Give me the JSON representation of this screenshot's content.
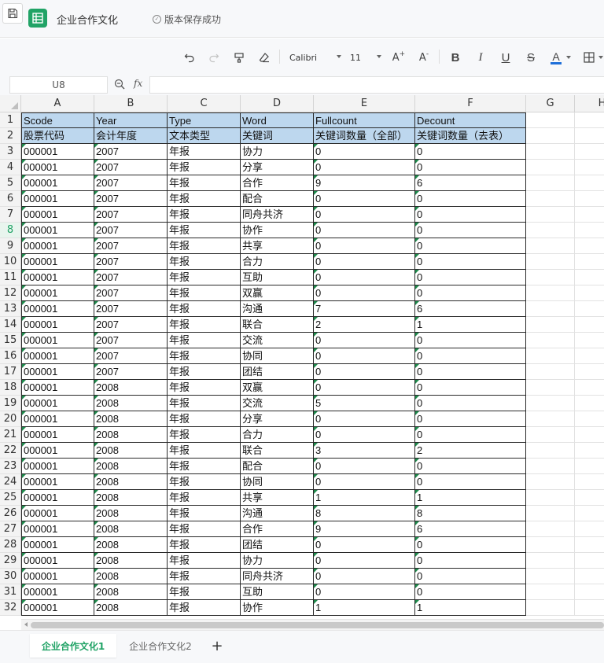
{
  "app": {
    "title": "企业合作文化",
    "save_status": "版本保存成功",
    "accent": "#21a366"
  },
  "toolbar": {
    "font": "Calibri",
    "size": "11",
    "bold": "B",
    "italic": "I",
    "underline": "U",
    "strike": "S",
    "font_color": "A",
    "grow": "A",
    "shrink": "A",
    "icons": [
      "undo-icon",
      "redo-icon",
      "format-painter-icon",
      "eraser-icon",
      "borders-icon"
    ]
  },
  "formula_bar": {
    "cell_ref": "U8",
    "fx": "fx",
    "value": ""
  },
  "grid": {
    "columns": [
      "A",
      "B",
      "C",
      "D",
      "E",
      "F",
      "G",
      "H"
    ],
    "rows": [
      [
        "Scode",
        "Year",
        "Type",
        "Word",
        "Fullcount",
        "Decount"
      ],
      [
        "股票代码",
        "会计年度",
        "文本类型",
        "关键词",
        "关键词数量（全部）",
        "关键词数量（去表）"
      ],
      [
        "000001",
        "2007",
        "年报",
        "协力",
        "0",
        "0"
      ],
      [
        "000001",
        "2007",
        "年报",
        "分享",
        "0",
        "0"
      ],
      [
        "000001",
        "2007",
        "年报",
        "合作",
        "9",
        "6"
      ],
      [
        "000001",
        "2007",
        "年报",
        "配合",
        "0",
        "0"
      ],
      [
        "000001",
        "2007",
        "年报",
        "同舟共济",
        "0",
        "0"
      ],
      [
        "000001",
        "2007",
        "年报",
        "协作",
        "0",
        "0"
      ],
      [
        "000001",
        "2007",
        "年报",
        "共享",
        "0",
        "0"
      ],
      [
        "000001",
        "2007",
        "年报",
        "合力",
        "0",
        "0"
      ],
      [
        "000001",
        "2007",
        "年报",
        "互助",
        "0",
        "0"
      ],
      [
        "000001",
        "2007",
        "年报",
        "双赢",
        "0",
        "0"
      ],
      [
        "000001",
        "2007",
        "年报",
        "沟通",
        "7",
        "6"
      ],
      [
        "000001",
        "2007",
        "年报",
        "联合",
        "2",
        "1"
      ],
      [
        "000001",
        "2007",
        "年报",
        "交流",
        "0",
        "0"
      ],
      [
        "000001",
        "2007",
        "年报",
        "协同",
        "0",
        "0"
      ],
      [
        "000001",
        "2007",
        "年报",
        "团结",
        "0",
        "0"
      ],
      [
        "000001",
        "2008",
        "年报",
        "双赢",
        "0",
        "0"
      ],
      [
        "000001",
        "2008",
        "年报",
        "交流",
        "5",
        "0"
      ],
      [
        "000001",
        "2008",
        "年报",
        "分享",
        "0",
        "0"
      ],
      [
        "000001",
        "2008",
        "年报",
        "合力",
        "0",
        "0"
      ],
      [
        "000001",
        "2008",
        "年报",
        "联合",
        "3",
        "2"
      ],
      [
        "000001",
        "2008",
        "年报",
        "配合",
        "0",
        "0"
      ],
      [
        "000001",
        "2008",
        "年报",
        "协同",
        "0",
        "0"
      ],
      [
        "000001",
        "2008",
        "年报",
        "共享",
        "1",
        "1"
      ],
      [
        "000001",
        "2008",
        "年报",
        "沟通",
        "8",
        "8"
      ],
      [
        "000001",
        "2008",
        "年报",
        "合作",
        "9",
        "6"
      ],
      [
        "000001",
        "2008",
        "年报",
        "团结",
        "0",
        "0"
      ],
      [
        "000001",
        "2008",
        "年报",
        "协力",
        "0",
        "0"
      ],
      [
        "000001",
        "2008",
        "年报",
        "同舟共济",
        "0",
        "0"
      ],
      [
        "000001",
        "2008",
        "年报",
        "互助",
        "0",
        "0"
      ],
      [
        "000001",
        "2008",
        "年报",
        "协作",
        "1",
        "1"
      ]
    ],
    "active_row": 8,
    "header_fill": "#bdd7ee"
  },
  "sheets": {
    "tabs": [
      "企业合作文化1",
      "企业合作文化2"
    ],
    "active": 0,
    "add": "+"
  }
}
